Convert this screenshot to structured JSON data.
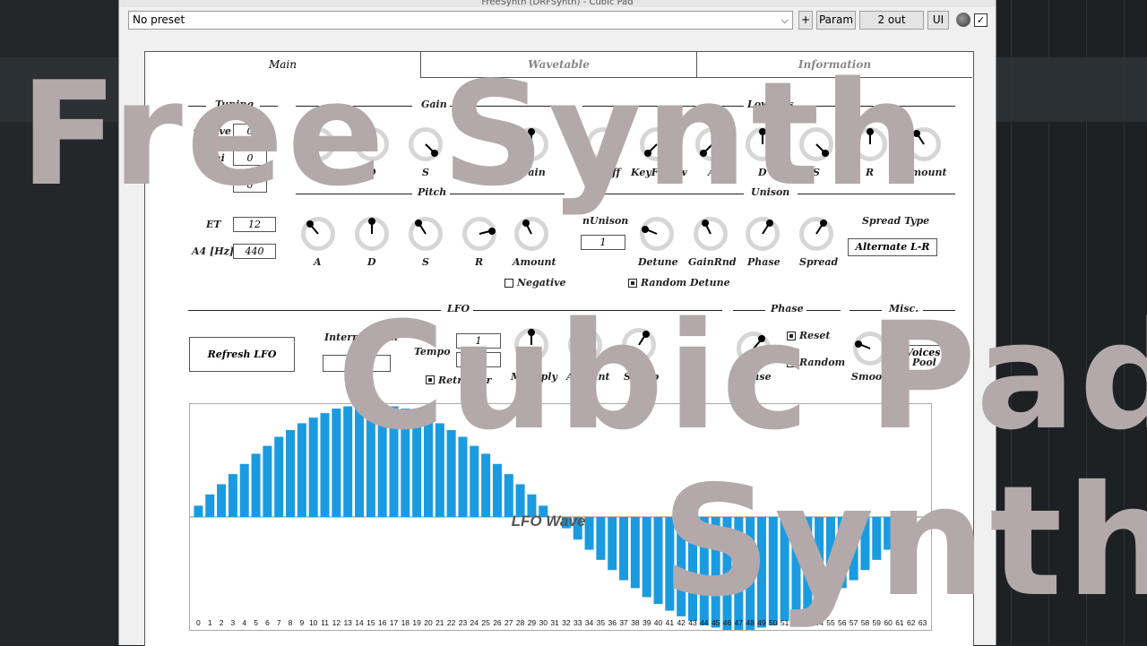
{
  "window": {
    "title": "FreeSynth (DRFSynth) - Cubic Pad"
  },
  "topbar": {
    "preset": "No preset",
    "plus_label": "+",
    "param_label": "Param",
    "out_label": "2 out",
    "ui_label": "UI",
    "enabled_mark": "✓"
  },
  "tabs": [
    {
      "label": "Main"
    },
    {
      "label": "Wavetable"
    },
    {
      "label": "Information"
    }
  ],
  "tuning": {
    "header": "Tuning",
    "octave_label": "Octave",
    "semi_label": "Semi",
    "octave": "0",
    "semi": "0",
    "fine": "0"
  },
  "gain": {
    "header": "Gain",
    "knobs": [
      {
        "label": "A",
        "level": 0.0
      },
      {
        "label": "D",
        "level": 0.5
      },
      {
        "label": "S",
        "level": 1.0
      },
      {
        "label": "Gain",
        "level": 0.5
      }
    ]
  },
  "lowpass": {
    "header": "Lowpass",
    "knobs": [
      {
        "label": "Cutoff",
        "level": 1.0
      },
      {
        "label": "KeyFollow",
        "level": 0.0
      },
      {
        "label": "A",
        "level": 0.0
      },
      {
        "label": "D",
        "level": 0.5
      },
      {
        "label": "S",
        "level": 1.0
      },
      {
        "label": "R",
        "level": 0.5
      },
      {
        "label": "Amount",
        "level": 0.38
      }
    ]
  },
  "pitch": {
    "header": "Pitch",
    "et_label": "ET",
    "et": "12",
    "a4_label": "A4 [Hz]",
    "a4": "440",
    "knobs": [
      {
        "label": "A",
        "level": 0.35
      },
      {
        "label": "D",
        "level": 0.5
      },
      {
        "label": "S",
        "level": 0.38
      },
      {
        "label": "R",
        "level": 0.78
      },
      {
        "label": "Amount",
        "level": 0.4
      }
    ],
    "negative_label": "Negative",
    "negative": false
  },
  "unison": {
    "header": "Unison",
    "nunison_label": "nUnison",
    "nunison": "1",
    "knobs": [
      {
        "label": "Detune",
        "level": 0.25
      },
      {
        "label": "GainRnd",
        "level": 0.4
      },
      {
        "label": "Phase",
        "level": 0.62
      },
      {
        "label": "Spread",
        "level": 0.62
      }
    ],
    "random_detune_label": "Random Detune",
    "random_detune": true,
    "spread_type_label": "Spread Type",
    "spread_type": "Alternate L-R"
  },
  "lfo": {
    "header": "LFO",
    "refresh_label": "Refresh LFO",
    "interpolation_label": "Interpolation",
    "interpolation": "",
    "tempo_label": "Tempo",
    "tempo_num": "1",
    "tempo_den": "1",
    "retrigger_label": "Retrigger",
    "retrigger": true,
    "knobs": [
      {
        "label": "Multiply",
        "level": 0.5
      },
      {
        "label": "Amount",
        "level": 0.38
      },
      {
        "label": "Sweep",
        "level": 0.62
      }
    ],
    "wave_label": "LFO Wave"
  },
  "phase": {
    "header": "Phase",
    "reset_label": "Reset",
    "reset": true,
    "random_label": "Random",
    "random": true,
    "knob": {
      "label": "Phase",
      "level": 0.65
    }
  },
  "misc": {
    "header": "Misc.",
    "voices": "32 Voices",
    "smooth": {
      "label": "Smooth",
      "level": 0.25
    },
    "pool_label": "Pool"
  },
  "chart_data": {
    "type": "bar",
    "title": "LFO Wave",
    "categories": [
      "0",
      "1",
      "2",
      "3",
      "4",
      "5",
      "6",
      "7",
      "8",
      "9",
      "10",
      "11",
      "12",
      "13",
      "14",
      "15",
      "16",
      "17",
      "18",
      "19",
      "20",
      "21",
      "22",
      "23",
      "24",
      "25",
      "26",
      "27",
      "28",
      "29",
      "30",
      "31",
      "32",
      "33",
      "34",
      "35",
      "36",
      "37",
      "38",
      "39",
      "40",
      "41",
      "42",
      "43",
      "44",
      "45",
      "46",
      "47",
      "48",
      "49",
      "50",
      "51",
      "52",
      "53",
      "54",
      "55",
      "56",
      "57",
      "58",
      "59",
      "60",
      "61",
      "62",
      "63"
    ],
    "values": [
      0.1,
      0.2,
      0.29,
      0.38,
      0.47,
      0.56,
      0.63,
      0.71,
      0.77,
      0.83,
      0.88,
      0.92,
      0.96,
      0.98,
      1.0,
      1.0,
      1.0,
      0.98,
      0.96,
      0.92,
      0.88,
      0.83,
      0.77,
      0.71,
      0.63,
      0.56,
      0.47,
      0.38,
      0.29,
      0.2,
      0.1,
      0.0,
      -0.1,
      -0.2,
      -0.29,
      -0.38,
      -0.47,
      -0.56,
      -0.63,
      -0.71,
      -0.77,
      -0.83,
      -0.88,
      -0.92,
      -0.96,
      -0.98,
      -1.0,
      -1.0,
      -1.0,
      -0.98,
      -0.96,
      -0.92,
      -0.88,
      -0.83,
      -0.77,
      -0.71,
      -0.63,
      -0.56,
      -0.47,
      -0.38,
      -0.29,
      -0.2,
      -0.1,
      0.0
    ],
    "ylim": [
      -1,
      1
    ],
    "bar_color": "#1a9be0"
  },
  "overlay": {
    "line1": "Free Synth",
    "line2": "Cubic Pad",
    "line3": "Synth",
    "color": "#b3a9aa"
  }
}
